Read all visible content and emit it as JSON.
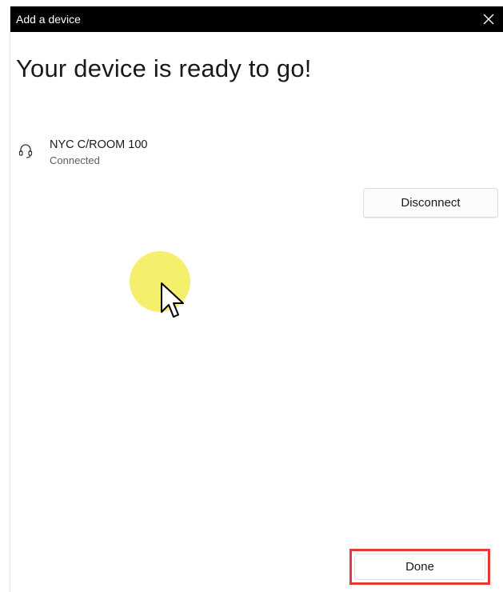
{
  "window": {
    "title": "Add a device",
    "close_icon": "close-icon"
  },
  "main": {
    "heading": "Your device is ready to go!"
  },
  "device": {
    "icon": "headset-icon",
    "name": "NYC C/ROOM 100",
    "status": "Connected",
    "disconnect_label": "Disconnect"
  },
  "footer": {
    "done_label": "Done"
  },
  "colors": {
    "titlebar": "#000000",
    "highlight_ring": "#f4ef6d",
    "done_annotation_border": "#e53935"
  }
}
